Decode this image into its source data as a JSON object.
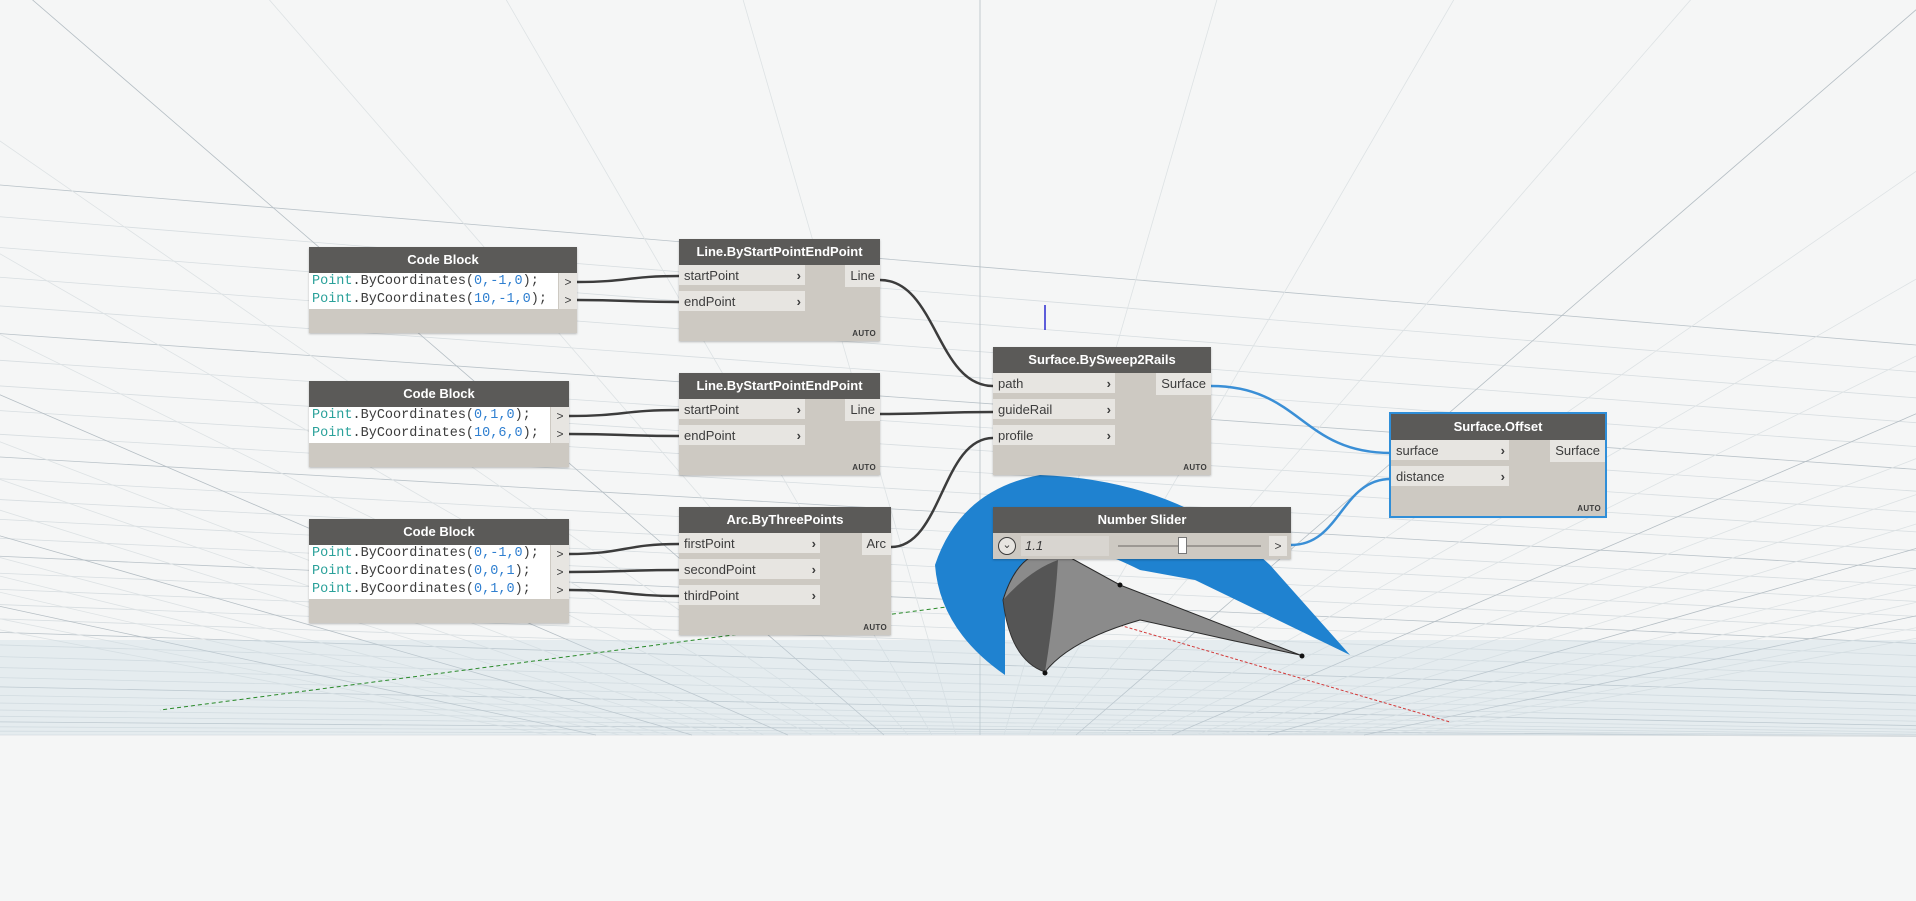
{
  "canvas": {
    "background": "#f5f6f6",
    "wire_color": "#3c3c3c",
    "selected_wire_color": "#3a8fd6",
    "surface_color": "#1f82d0"
  },
  "nodes": {
    "code1": {
      "title": "Code Block",
      "lines": [
        {
          "cls": "Point",
          "fn": ".ByCoordinates(",
          "args": "0,-1,0",
          "end": ");"
        },
        {
          "cls": "Point",
          "fn": ".ByCoordinates(",
          "args": "10,-1,0",
          "end": ");"
        }
      ],
      "out": ">"
    },
    "code2": {
      "title": "Code Block",
      "lines": [
        {
          "cls": "Point",
          "fn": ".ByCoordinates(",
          "args": "0,1,0",
          "end": ");"
        },
        {
          "cls": "Point",
          "fn": ".ByCoordinates(",
          "args": "10,6,0",
          "end": ");"
        }
      ],
      "out": ">"
    },
    "code3": {
      "title": "Code Block",
      "lines": [
        {
          "cls": "Point",
          "fn": ".ByCoordinates(",
          "args": "0,-1,0",
          "end": ");"
        },
        {
          "cls": "Point",
          "fn": ".ByCoordinates(",
          "args": "0,0,1",
          "end": ");"
        },
        {
          "cls": "Point",
          "fn": ".ByCoordinates(",
          "args": "0,1,0",
          "end": ");"
        }
      ],
      "out": ">"
    },
    "line1": {
      "title": "Line.ByStartPointEndPoint",
      "inputs": [
        "startPoint",
        "endPoint"
      ],
      "output": "Line",
      "lacing": "AUTO"
    },
    "line2": {
      "title": "Line.ByStartPointEndPoint",
      "inputs": [
        "startPoint",
        "endPoint"
      ],
      "output": "Line",
      "lacing": "AUTO"
    },
    "arc": {
      "title": "Arc.ByThreePoints",
      "inputs": [
        "firstPoint",
        "secondPoint",
        "thirdPoint"
      ],
      "output": "Arc",
      "lacing": "AUTO"
    },
    "sweep": {
      "title": "Surface.BySweep2Rails",
      "inputs": [
        "path",
        "guideRail",
        "profile"
      ],
      "output": "Surface",
      "lacing": "AUTO"
    },
    "slider": {
      "title": "Number Slider",
      "value": "1.1",
      "position": 0.45,
      "toggle": "⌄",
      "out": ">"
    },
    "offset": {
      "title": "Surface.Offset",
      "inputs": [
        "surface",
        "distance"
      ],
      "output": "Surface",
      "lacing": "AUTO",
      "selected": true
    }
  }
}
